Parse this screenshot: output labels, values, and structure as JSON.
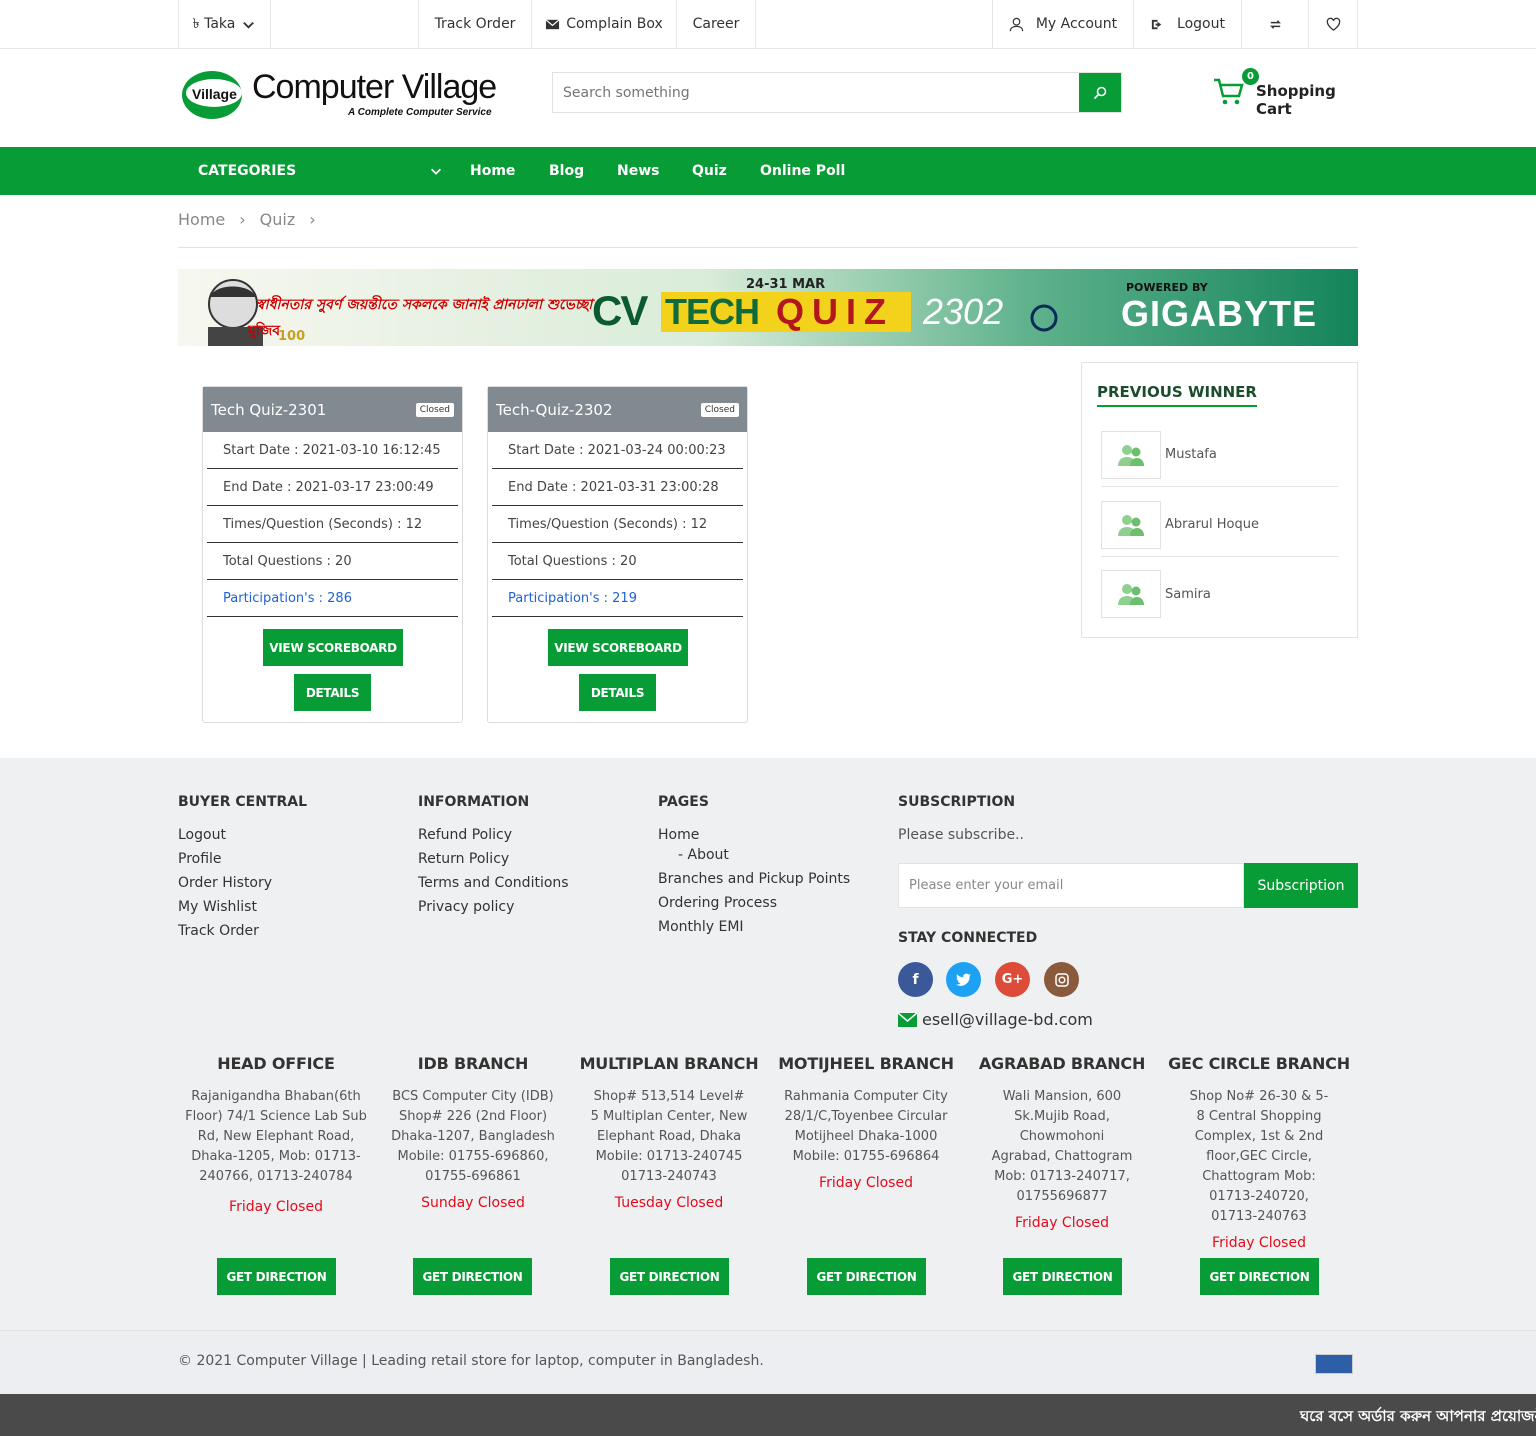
{
  "topbar": {
    "currency": "৳ Taka",
    "track_order": "Track Order",
    "complain_box": "Complain Box",
    "career": "Career",
    "my_account": "My Account",
    "logout": "Logout"
  },
  "header": {
    "logo_text": "Computer Village",
    "logo_badge": "Village",
    "logo_tagline": "A Complete Computer Service",
    "search_placeholder": "Search something",
    "cart_count": "0",
    "cart_label": "Shopping Cart"
  },
  "nav": {
    "categories": "CATEGORIES",
    "items": [
      "Home",
      "Blog",
      "News",
      "Quiz",
      "Online Poll"
    ]
  },
  "breadcrumb": [
    "Home",
    "Quiz"
  ],
  "banner": {
    "bangla_text": "স্বাধীনতার সুবর্ণ জয়ন্তীতে সকলকে জানাই প্রানঢালা শুভেচ্ছা",
    "date": "24-31 MAR",
    "cv": "CV",
    "tech": "TECH",
    "quiz": "QUIZ",
    "number": "2302",
    "powered_by": "POWERED BY",
    "sponsor": "GIGABYTE",
    "mujib": "মুজিব",
    "mujib_100": "100"
  },
  "quizzes": [
    {
      "title": "Tech Quiz-2301",
      "status": "Closed",
      "start": "Start Date : 2021-03-10 16:12:45",
      "end": "End Date : 2021-03-17 23:00:49",
      "times": "Times/Question (Seconds) : 12",
      "total": "Total Questions : 20",
      "participation": "Participation's : 286",
      "scoreboard_btn": "VIEW SCOREBOARD",
      "details_btn": "DETAILS"
    },
    {
      "title": "Tech-Quiz-2302",
      "status": "Closed",
      "start": "Start Date : 2021-03-24 00:00:23",
      "end": "End Date : 2021-03-31 23:00:28",
      "times": "Times/Question (Seconds) : 12",
      "total": "Total Questions : 20",
      "participation": "Participation's : 219",
      "scoreboard_btn": "VIEW SCOREBOARD",
      "details_btn": "DETAILS"
    }
  ],
  "winners": {
    "title": "PREVIOUS WINNER",
    "names": [
      "Mustafa",
      "Abrarul Hoque",
      "Samira"
    ]
  },
  "footer": {
    "buyer_central": {
      "title": "BUYER CENTRAL",
      "links": [
        "Logout",
        "Profile",
        "Order History",
        "My Wishlist",
        "Track Order"
      ]
    },
    "information": {
      "title": "INFORMATION",
      "links": [
        "Refund Policy",
        "Return Policy",
        "Terms and Conditions",
        "Privacy policy"
      ]
    },
    "pages": {
      "title": "PAGES",
      "home": "Home",
      "about": "- About",
      "links": [
        "Branches and Pickup Points",
        "Ordering Process",
        "Monthly EMI"
      ]
    },
    "subscription": {
      "title": "SUBSCRIPTION",
      "text": "Please subscribe..",
      "placeholder": "Please enter your email",
      "button": "Subscription",
      "stay_connected": "STAY CONNECTED",
      "email": "esell@village-bd.com"
    },
    "branches": [
      {
        "name": "HEAD OFFICE",
        "address": "Rajanigandha Bhaban(6th Floor) 74/1 Science Lab Sub Rd, New Elephant Road, Dhaka-1205, Mob: 01713-240766, 01713-240784",
        "closed": "Friday Closed",
        "button": "GET DIRECTION"
      },
      {
        "name": "IDB BRANCH",
        "address": "BCS Computer City (IDB) Shop# 226 (2nd Floor) Dhaka-1207, Bangladesh Mobile: 01755-696860, 01755-696861",
        "closed": "Sunday Closed",
        "button": "GET DIRECTION"
      },
      {
        "name": "MULTIPLAN BRANCH",
        "address": "Shop# 513,514 Level# 5 Multiplan Center, New Elephant Road, Dhaka Mobile: 01713-240745 01713-240743",
        "closed": "Tuesday Closed",
        "button": "GET DIRECTION"
      },
      {
        "name": "MOTIJHEEL BRANCH",
        "address": "Rahmania Computer City 28/1/C,Toyenbee Circular Motijheel Dhaka-1000 Mobile: 01755-696864",
        "closed": "Friday Closed",
        "button": "GET DIRECTION"
      },
      {
        "name": "AGRABAD BRANCH",
        "address": "Wali Mansion, 600 Sk.Mujib Road, Chowmohoni Agrabad, Chattogram Mob: 01713-240717, 01755696877",
        "closed": "Friday Closed",
        "button": "GET DIRECTION"
      },
      {
        "name": "GEC CIRCLE BRANCH",
        "address": "Shop No# 26-30 & 5-8 Central Shopping Complex, 1st & 2nd floor,GEC Circle, Chattogram Mob: 01713-240720, 01713-240763",
        "closed": "Friday Closed",
        "button": "GET DIRECTION"
      }
    ],
    "copyright": "© 2021 Computer Village | Leading retail store for laptop, computer in Bangladesh.",
    "marquee": "ঘরে বসে অর্ডার করুন আপনার প্রয়োজনী"
  },
  "colors": {
    "brand_green": "#089c36",
    "closed_red": "#e30b1c",
    "participation_blue": "#1f62d4"
  }
}
